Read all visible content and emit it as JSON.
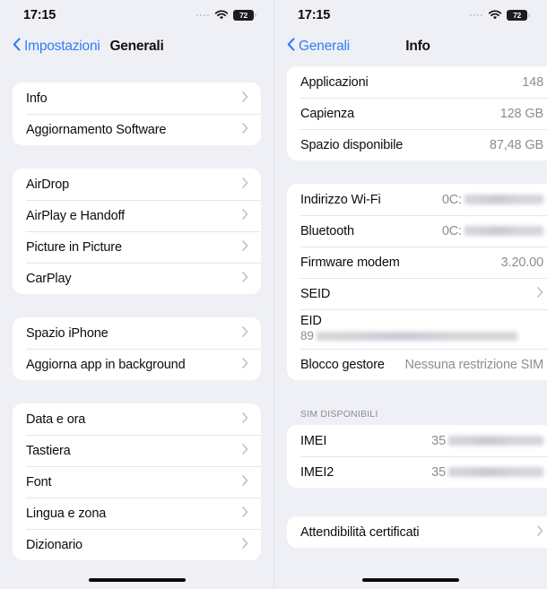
{
  "left": {
    "statusbar": {
      "time": "17:15",
      "battery_percent": "72"
    },
    "nav": {
      "back_label": "Impostazioni",
      "title": "Generali"
    },
    "groups": [
      {
        "rows": [
          {
            "label": "Info",
            "accessory": "chevron"
          },
          {
            "label": "Aggiornamento Software",
            "accessory": "chevron"
          }
        ]
      },
      {
        "rows": [
          {
            "label": "AirDrop",
            "accessory": "chevron"
          },
          {
            "label": "AirPlay e Handoff",
            "accessory": "chevron"
          },
          {
            "label": "Picture in Picture",
            "accessory": "chevron"
          },
          {
            "label": "CarPlay",
            "accessory": "chevron"
          }
        ]
      },
      {
        "rows": [
          {
            "label": "Spazio iPhone",
            "accessory": "chevron"
          },
          {
            "label": "Aggiorna app in background",
            "accessory": "chevron"
          }
        ]
      },
      {
        "rows": [
          {
            "label": "Data e ora",
            "accessory": "chevron"
          },
          {
            "label": "Tastiera",
            "accessory": "chevron"
          },
          {
            "label": "Font",
            "accessory": "chevron"
          },
          {
            "label": "Lingua e zona",
            "accessory": "chevron"
          },
          {
            "label": "Dizionario",
            "accessory": "chevron"
          }
        ]
      }
    ]
  },
  "right": {
    "statusbar": {
      "time": "17:15",
      "battery_percent": "72"
    },
    "nav": {
      "back_label": "Generali",
      "title": "Info"
    },
    "group1": {
      "rows": [
        {
          "label": "Applicazioni",
          "value": "148"
        },
        {
          "label": "Capienza",
          "value": "128 GB"
        },
        {
          "label": "Spazio disponibile",
          "value": "87,48 GB"
        }
      ]
    },
    "group2": {
      "wifi": {
        "label": "Indirizzo Wi-Fi",
        "value_prefix": "0C:"
      },
      "bluetooth": {
        "label": "Bluetooth",
        "value_prefix": "0C:"
      },
      "firmware": {
        "label": "Firmware modem",
        "value": "3.20.00"
      },
      "seid": {
        "label": "SEID"
      },
      "eid": {
        "label": "EID",
        "value_prefix": "89"
      },
      "carrier_lock": {
        "label": "Blocco gestore",
        "value": "Nessuna restrizione SIM"
      }
    },
    "sim_section": {
      "header": "SIM DISPONIBILI",
      "rows": [
        {
          "label": "IMEI",
          "value_prefix": "35"
        },
        {
          "label": "IMEI2",
          "value_prefix": "35"
        }
      ]
    },
    "group4": {
      "rows": [
        {
          "label": "Attendibilità certificati",
          "accessory": "chevron"
        }
      ]
    }
  },
  "colors": {
    "accent": "#2f7df6",
    "background": "#eff0f5",
    "card": "#ffffff",
    "secondary_text": "#8d8d94"
  }
}
